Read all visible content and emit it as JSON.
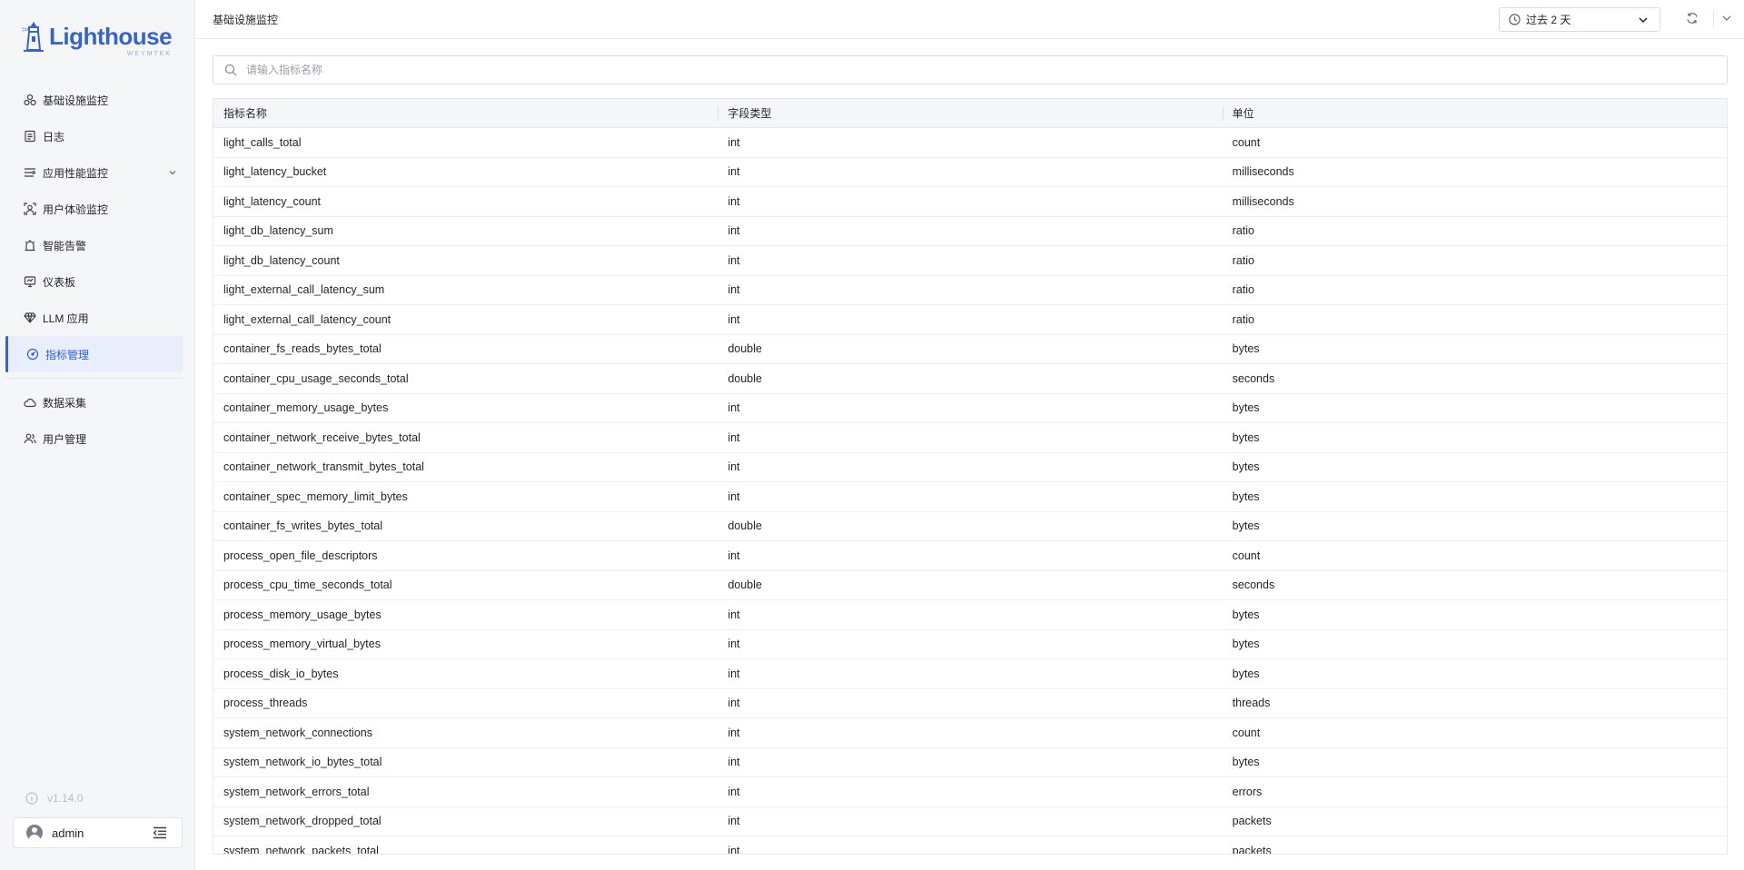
{
  "brand": {
    "name": "Lighthouse",
    "subtitle": "WEYMTEK"
  },
  "sidebar": {
    "items": [
      {
        "label": "基础设施监控",
        "icon": "infrastructure-icon"
      },
      {
        "label": "日志",
        "icon": "log-icon"
      },
      {
        "label": "应用性能监控",
        "icon": "apm-icon",
        "expandable": true
      },
      {
        "label": "用户体验监控",
        "icon": "user-experience-icon"
      },
      {
        "label": "智能告警",
        "icon": "alert-icon"
      },
      {
        "label": "仪表板",
        "icon": "dashboard-icon"
      },
      {
        "label": "LLM 应用",
        "icon": "llm-icon"
      },
      {
        "label": "指标管理",
        "icon": "metrics-icon",
        "active": true
      },
      {
        "label": "数据采集",
        "icon": "data-collection-icon"
      },
      {
        "label": "用户管理",
        "icon": "user-management-icon"
      }
    ],
    "version": "v1.14.0",
    "user": "admin"
  },
  "header": {
    "title": "基础设施监控",
    "time_range": "过去 2 天"
  },
  "search": {
    "placeholder": "请输入指标名称",
    "value": ""
  },
  "table": {
    "columns": [
      "指标名称",
      "字段类型",
      "单位"
    ],
    "rows": [
      [
        "light_calls_total",
        "int",
        "count"
      ],
      [
        "light_latency_bucket",
        "int",
        "milliseconds"
      ],
      [
        "light_latency_count",
        "int",
        "milliseconds"
      ],
      [
        "light_db_latency_sum",
        "int",
        "ratio"
      ],
      [
        "light_db_latency_count",
        "int",
        "ratio"
      ],
      [
        "light_external_call_latency_sum",
        "int",
        "ratio"
      ],
      [
        "light_external_call_latency_count",
        "int",
        "ratio"
      ],
      [
        "container_fs_reads_bytes_total",
        "double",
        "bytes"
      ],
      [
        "container_cpu_usage_seconds_total",
        "double",
        "seconds"
      ],
      [
        "container_memory_usage_bytes",
        "int",
        "bytes"
      ],
      [
        "container_network_receive_bytes_total",
        "int",
        "bytes"
      ],
      [
        "container_network_transmit_bytes_total",
        "int",
        "bytes"
      ],
      [
        "container_spec_memory_limit_bytes",
        "int",
        "bytes"
      ],
      [
        "container_fs_writes_bytes_total",
        "double",
        "bytes"
      ],
      [
        "process_open_file_descriptors",
        "int",
        "count"
      ],
      [
        "process_cpu_time_seconds_total",
        "double",
        "seconds"
      ],
      [
        "process_memory_usage_bytes",
        "int",
        "bytes"
      ],
      [
        "process_memory_virtual_bytes",
        "int",
        "bytes"
      ],
      [
        "process_disk_io_bytes",
        "int",
        "bytes"
      ],
      [
        "process_threads",
        "int",
        "threads"
      ],
      [
        "system_network_connections",
        "int",
        "count"
      ],
      [
        "system_network_io_bytes_total",
        "int",
        "bytes"
      ],
      [
        "system_network_errors_total",
        "int",
        "errors"
      ],
      [
        "system_network_dropped_total",
        "int",
        "packets"
      ],
      [
        "system_network_packets_total",
        "int",
        "packets"
      ]
    ]
  },
  "colors": {
    "accent": "#3a63c7",
    "active_bg": "#e8eefc",
    "sidebar_bg": "#f5f6f8"
  }
}
